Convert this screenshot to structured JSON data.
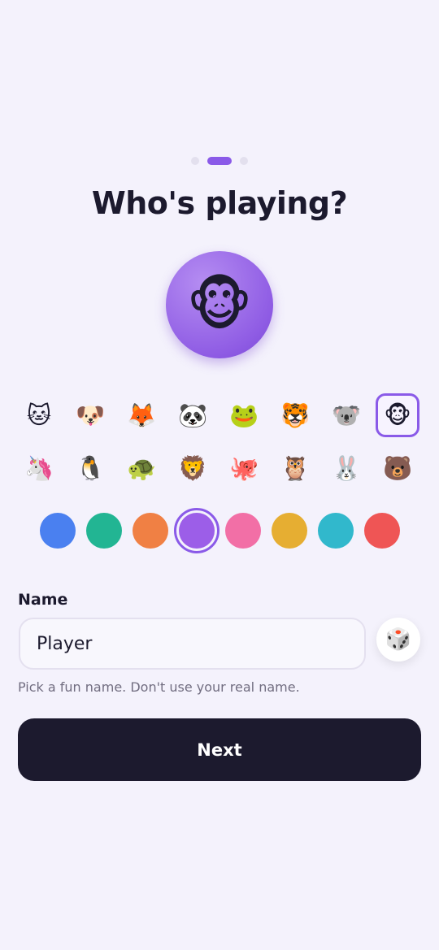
{
  "progress": {
    "steps": 3,
    "current": 2
  },
  "title": "Who's playing?",
  "selected_avatar": "🐵",
  "avatars_row1": [
    {
      "emoji": "🐱",
      "name": "cat"
    },
    {
      "emoji": "🐶",
      "name": "dog"
    },
    {
      "emoji": "🦊",
      "name": "fox"
    },
    {
      "emoji": "🐼",
      "name": "panda"
    },
    {
      "emoji": "🐸",
      "name": "frog"
    },
    {
      "emoji": "🐯",
      "name": "tiger"
    },
    {
      "emoji": "🐨",
      "name": "koala"
    },
    {
      "emoji": "🐵",
      "name": "monkey",
      "selected": true
    }
  ],
  "avatars_row2": [
    {
      "emoji": "🦄",
      "name": "unicorn"
    },
    {
      "emoji": "🐧",
      "name": "penguin"
    },
    {
      "emoji": "🐢",
      "name": "turtle"
    },
    {
      "emoji": "🦁",
      "name": "lion"
    },
    {
      "emoji": "🐙",
      "name": "octopus"
    },
    {
      "emoji": "🦉",
      "name": "owl"
    },
    {
      "emoji": "🐰",
      "name": "rabbit"
    },
    {
      "emoji": "🐻",
      "name": "bear"
    }
  ],
  "colors": [
    {
      "name": "blue",
      "hex": "#4a80f0"
    },
    {
      "name": "green",
      "hex": "#22b593"
    },
    {
      "name": "orange",
      "hex": "#f08044"
    },
    {
      "name": "purple",
      "hex": "#9c5ee8",
      "selected": true
    },
    {
      "name": "pink",
      "hex": "#f26fa6"
    },
    {
      "name": "yellow",
      "hex": "#e6ae32"
    },
    {
      "name": "teal",
      "hex": "#31b8cc"
    },
    {
      "name": "red",
      "hex": "#ef5555"
    }
  ],
  "name_field": {
    "label": "Name",
    "value": "Player"
  },
  "dice_icon": "🎲",
  "hint": "Pick a fun name. Don't use your real name.",
  "next_label": "Next"
}
